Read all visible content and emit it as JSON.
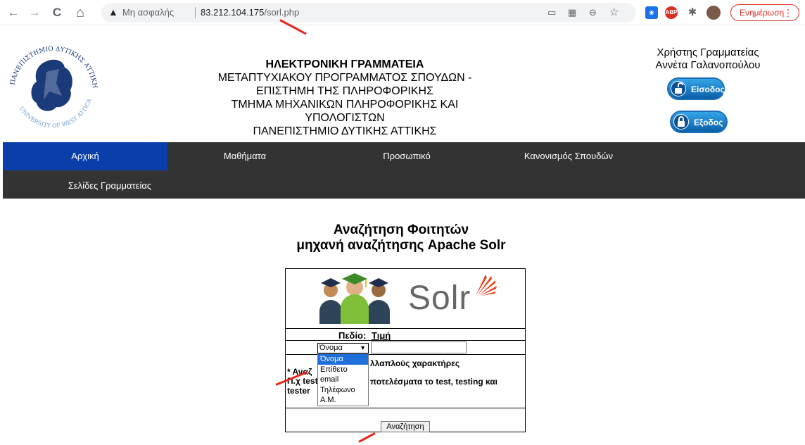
{
  "browser": {
    "back_glyph": "←",
    "forward_glyph": "→",
    "reload_glyph": "C",
    "home_glyph": "⌂",
    "warning_glyph": "▲",
    "insecure_label": "Μη ασφαλής",
    "url_host": "83.212.104.175",
    "url_path": "/sorl.php",
    "update_label": "Ενημέρωση",
    "menu_glyph": "⋮",
    "abp_label": "ABP"
  },
  "header": {
    "title": "ΗΛΕΚΤΡΟΝΙΚΗ ΓΡΑΜΜΑΤΕΙΑ",
    "line1": "ΜΕΤΑΠΤΥΧΙΑΚΟΥ ΠΡΟΓΡΑΜΜΑΤΟΣ ΣΠΟΥΔΩΝ - ΕΠΙΣΤΗΜΗ ΤΗΣ ΠΛΗΡΟΦΟΡΙΚΗΣ",
    "line2": "ΤΜΗΜΑ ΜΗΧΑΝΙΚΩΝ ΠΛΗΡΟΦΟΡΙΚΗΣ ΚΑΙ ΥΠΟΛΟΓΙΣΤΩΝ",
    "line3": "ΠΑΝΕΠΙΣΤΗΜΙΟ ΔΥΤΙΚΗΣ ΑΤΤΙΚΗΣ",
    "logo_top_text": "ΠΑΝΕΠΙΣΤΗΜΙΟ ΔΥΤΙΚΗΣ ΑΤΤΙΚΗΣ",
    "logo_bottom_text": "UNIVERSITY OF WEST ATTICA"
  },
  "user": {
    "role": "Χρήστης Γραμματείας",
    "name": "Αννέτα Γαλανοπούλου",
    "login_label": "Είσοδος",
    "logout_label": "Εξοδος"
  },
  "menu": {
    "home": "Αρχική",
    "courses": "Μαθήματα",
    "staff": "Προσωπικό",
    "regulation": "Κανονισμός Σπουδών",
    "secretariat": "Σελίδες Γραμματείας"
  },
  "main": {
    "heading1": "Αναζήτηση Φοιτητών",
    "heading2": "μηχανή αναζήτησης Apache Solr",
    "solr_logo_text": "Solr",
    "field_label": "Πεδίο:",
    "value_label": "Τιμή",
    "selected_field": "Όνομα",
    "search_value": "",
    "options": [
      "Όνομα",
      "Επίθετο",
      "email",
      "Τηλέφωνο",
      "Α.Μ."
    ],
    "note_a": "* Αναζ",
    "note_b": "λλαπλούς χαρακτήρες",
    "note_c": "Π.χ test",
    "note_d": "ποτελέσματα το test, testing και",
    "note_e": "tester",
    "search_button": "Αναζήτηση"
  },
  "colors": {
    "menu_bg": "#333333",
    "menu_active": "#0a3ea8",
    "annotation": "#e8251c",
    "solr_orange": "#e8401c"
  }
}
